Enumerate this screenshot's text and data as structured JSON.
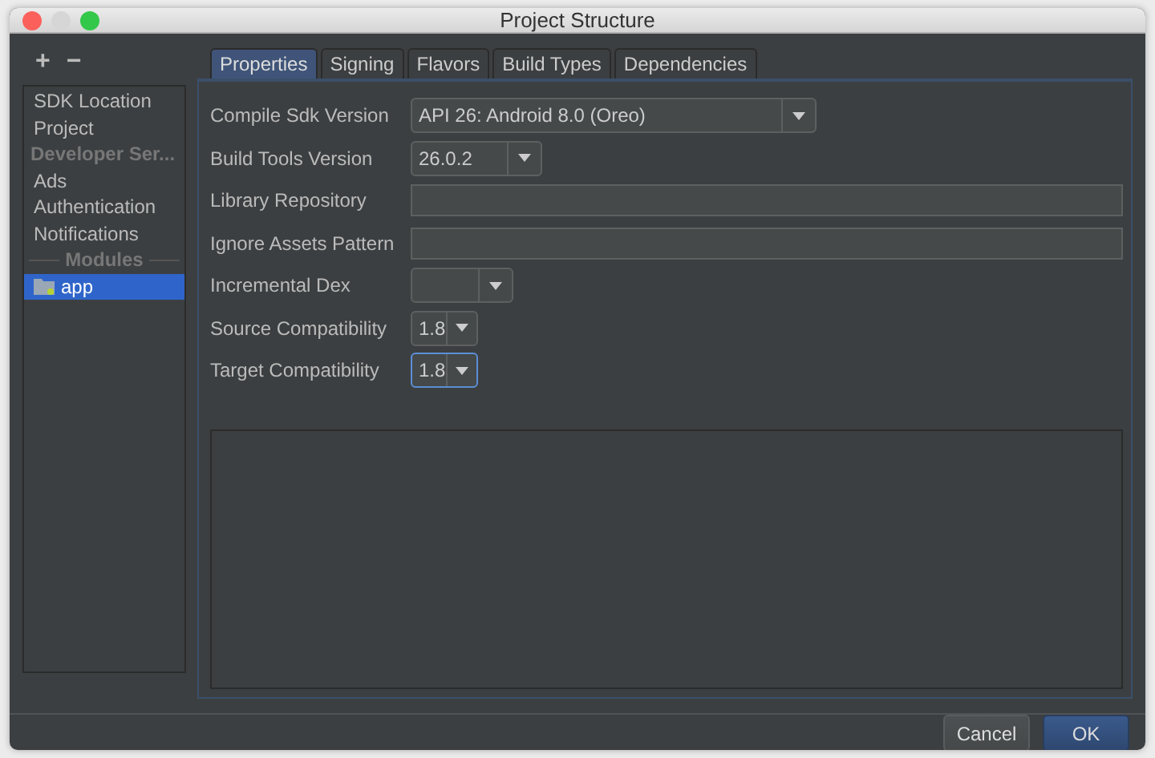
{
  "window": {
    "title": "Project Structure"
  },
  "sidebar": {
    "toolbar": [
      "+",
      "−"
    ],
    "items": [
      {
        "kind": "item",
        "label": "SDK Location",
        "selected": false
      },
      {
        "kind": "item",
        "label": "Project",
        "selected": false
      },
      {
        "kind": "header",
        "label": "Developer Ser..."
      },
      {
        "kind": "item",
        "label": "Ads",
        "selected": false
      },
      {
        "kind": "item",
        "label": "Authentication",
        "selected": false
      },
      {
        "kind": "item",
        "label": "Notifications",
        "selected": false
      },
      {
        "kind": "separator",
        "label": "Modules"
      },
      {
        "kind": "module",
        "label": "app",
        "selected": true
      }
    ]
  },
  "tabs": [
    {
      "label": "Properties",
      "selected": true
    },
    {
      "label": "Signing",
      "selected": false
    },
    {
      "label": "Flavors",
      "selected": false
    },
    {
      "label": "Build Types",
      "selected": false
    },
    {
      "label": "Dependencies",
      "selected": false
    }
  ],
  "properties": [
    {
      "label": "Compile Sdk Version",
      "kind": "combo",
      "value": "API 26: Android 8.0 (Oreo)",
      "focused": false
    },
    {
      "label": "Build Tools Version",
      "kind": "combo",
      "value": "26.0.2",
      "focused": false
    },
    {
      "label": "Library Repository",
      "kind": "text",
      "focused": false
    },
    {
      "label": "Ignore Assets Pattern",
      "kind": "text",
      "focused": false
    },
    {
      "label": "Incremental Dex",
      "kind": "combo",
      "focused": false
    },
    {
      "label": "Source Compatibility",
      "kind": "combo",
      "value": "1.8",
      "focused": false
    },
    {
      "label": "Target Compatibility",
      "kind": "combo",
      "value": "1.8",
      "focused": true
    }
  ],
  "buttons": [
    {
      "label": "Cancel",
      "default": false
    },
    {
      "label": "OK",
      "default": true
    }
  ]
}
